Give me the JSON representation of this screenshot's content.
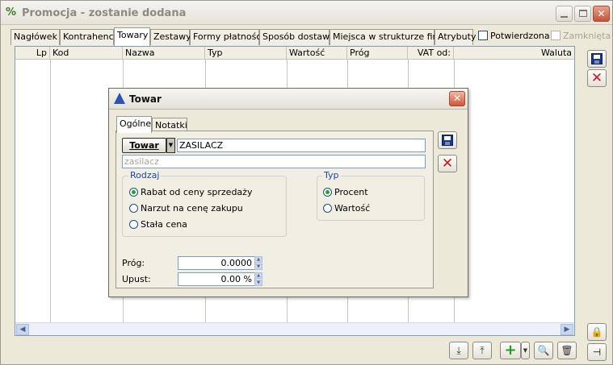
{
  "window": {
    "title": "Promocja - zostanie dodana",
    "app_icon": "percent-icon"
  },
  "tabs": [
    {
      "label": "Nagłówek"
    },
    {
      "label": "Kontrahenci"
    },
    {
      "label": "Towary",
      "active": true
    },
    {
      "label": "Zestawy"
    },
    {
      "label": "Formy płatności"
    },
    {
      "label": "Sposób dostawy"
    },
    {
      "label": "Miejsca w strukturze firmy"
    },
    {
      "label": "Atrybuty"
    }
  ],
  "checkboxes": {
    "potwierdzona": {
      "label": "Potwierdzona",
      "checked": false
    },
    "zamknieta": {
      "label": "Zamknięta",
      "checked": false,
      "disabled": true
    }
  },
  "grid": {
    "columns": [
      "Lp",
      "Kod",
      "Nazwa",
      "Typ",
      "Wartość",
      "Próg",
      "VAT od:",
      "Waluta"
    ]
  },
  "dialog": {
    "title": "Towar",
    "tabs": [
      {
        "label": "Ogólne",
        "active": true
      },
      {
        "label": "Notatki"
      }
    ],
    "towar_button": "Towar",
    "code_value": "ZASILACZ",
    "name_value": "zasilacz",
    "rodzaj": {
      "label": "Rodzaj",
      "options": [
        {
          "label": "Rabat od ceny sprzedaży",
          "selected": true
        },
        {
          "label": "Narzut na cenę zakupu",
          "selected": false
        },
        {
          "label": "Stała cena",
          "selected": false
        }
      ]
    },
    "typ": {
      "label": "Typ",
      "options": [
        {
          "label": "Procent",
          "selected": true
        },
        {
          "label": "Wartość",
          "selected": false
        }
      ]
    },
    "prog": {
      "label": "Próg:",
      "value": "0.0000"
    },
    "upust": {
      "label": "Upust:",
      "value": "0.00 %"
    }
  },
  "colors": {
    "accent_blue": "#17378a",
    "close_red": "#c8191e",
    "group_label": "#1c44ac"
  }
}
